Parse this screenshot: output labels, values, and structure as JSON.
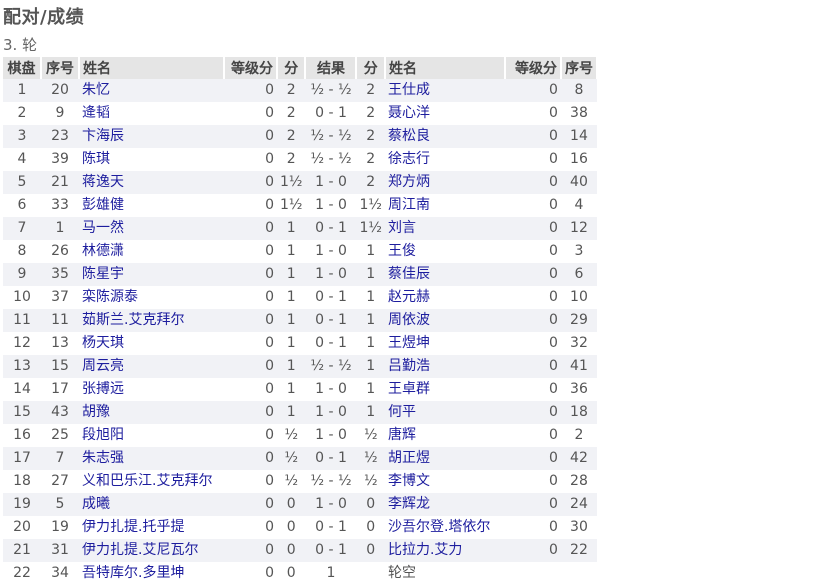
{
  "page_title": "配对/成绩",
  "round_label": "3. 轮",
  "headers": [
    "棋盘",
    "序号",
    "姓名",
    "等级分",
    "分",
    "结果",
    "分",
    "姓名",
    "等级分",
    "序号"
  ],
  "rows": [
    {
      "board": "1",
      "no1": "20",
      "name1": "朱忆",
      "rating1": "0",
      "pts1": "2",
      "result": "½ - ½",
      "pts2": "2",
      "name2": "王仕成",
      "rating2": "0",
      "no2": "8"
    },
    {
      "board": "2",
      "no1": "9",
      "name1": "逄韬",
      "rating1": "0",
      "pts1": "2",
      "result": "0 - 1",
      "pts2": "2",
      "name2": "聂心洋",
      "rating2": "0",
      "no2": "38"
    },
    {
      "board": "3",
      "no1": "23",
      "name1": "卞海辰",
      "rating1": "0",
      "pts1": "2",
      "result": "½ - ½",
      "pts2": "2",
      "name2": "蔡松良",
      "rating2": "0",
      "no2": "14"
    },
    {
      "board": "4",
      "no1": "39",
      "name1": "陈琪",
      "rating1": "0",
      "pts1": "2",
      "result": "½ - ½",
      "pts2": "2",
      "name2": "徐志行",
      "rating2": "0",
      "no2": "16"
    },
    {
      "board": "5",
      "no1": "21",
      "name1": "蒋逸天",
      "rating1": "0",
      "pts1": "1½",
      "result": "1 - 0",
      "pts2": "2",
      "name2": "郑方炳",
      "rating2": "0",
      "no2": "40"
    },
    {
      "board": "6",
      "no1": "33",
      "name1": "彭雄健",
      "rating1": "0",
      "pts1": "1½",
      "result": "1 - 0",
      "pts2": "1½",
      "name2": "周江南",
      "rating2": "0",
      "no2": "4"
    },
    {
      "board": "7",
      "no1": "1",
      "name1": "马一然",
      "rating1": "0",
      "pts1": "1",
      "result": "0 - 1",
      "pts2": "1½",
      "name2": "刘言",
      "rating2": "0",
      "no2": "12"
    },
    {
      "board": "8",
      "no1": "26",
      "name1": "林德潇",
      "rating1": "0",
      "pts1": "1",
      "result": "1 - 0",
      "pts2": "1",
      "name2": "王俊",
      "rating2": "0",
      "no2": "3"
    },
    {
      "board": "9",
      "no1": "35",
      "name1": "陈星宇",
      "rating1": "0",
      "pts1": "1",
      "result": "1 - 0",
      "pts2": "1",
      "name2": "蔡佳辰",
      "rating2": "0",
      "no2": "6"
    },
    {
      "board": "10",
      "no1": "37",
      "name1": "栾陈源泰",
      "rating1": "0",
      "pts1": "1",
      "result": "0 - 1",
      "pts2": "1",
      "name2": "赵元赫",
      "rating2": "0",
      "no2": "10"
    },
    {
      "board": "11",
      "no1": "11",
      "name1": "茹斯兰.艾克拜尔",
      "rating1": "0",
      "pts1": "1",
      "result": "0 - 1",
      "pts2": "1",
      "name2": "周依波",
      "rating2": "0",
      "no2": "29"
    },
    {
      "board": "12",
      "no1": "13",
      "name1": "杨天琪",
      "rating1": "0",
      "pts1": "1",
      "result": "0 - 1",
      "pts2": "1",
      "name2": "王煜坤",
      "rating2": "0",
      "no2": "32"
    },
    {
      "board": "13",
      "no1": "15",
      "name1": "周云亮",
      "rating1": "0",
      "pts1": "1",
      "result": "½ - ½",
      "pts2": "1",
      "name2": "吕勤浩",
      "rating2": "0",
      "no2": "41"
    },
    {
      "board": "14",
      "no1": "17",
      "name1": "张搏远",
      "rating1": "0",
      "pts1": "1",
      "result": "1 - 0",
      "pts2": "1",
      "name2": "王卓群",
      "rating2": "0",
      "no2": "36"
    },
    {
      "board": "15",
      "no1": "43",
      "name1": "胡豫",
      "rating1": "0",
      "pts1": "1",
      "result": "1 - 0",
      "pts2": "1",
      "name2": "何平",
      "rating2": "0",
      "no2": "18"
    },
    {
      "board": "16",
      "no1": "25",
      "name1": "段旭阳",
      "rating1": "0",
      "pts1": "½",
      "result": "1 - 0",
      "pts2": "½",
      "name2": "唐辉",
      "rating2": "0",
      "no2": "2"
    },
    {
      "board": "17",
      "no1": "7",
      "name1": "朱志强",
      "rating1": "0",
      "pts1": "½",
      "result": "0 - 1",
      "pts2": "½",
      "name2": "胡正煜",
      "rating2": "0",
      "no2": "42"
    },
    {
      "board": "18",
      "no1": "27",
      "name1": "义和巴乐江.艾克拜尔",
      "rating1": "0",
      "pts1": "½",
      "result": "½ - ½",
      "pts2": "½",
      "name2": "李博文",
      "rating2": "0",
      "no2": "28"
    },
    {
      "board": "19",
      "no1": "5",
      "name1": "成曦",
      "rating1": "0",
      "pts1": "0",
      "result": "1 - 0",
      "pts2": "0",
      "name2": "李辉龙",
      "rating2": "0",
      "no2": "24"
    },
    {
      "board": "20",
      "no1": "19",
      "name1": "伊力扎提.托乎提",
      "rating1": "0",
      "pts1": "0",
      "result": "0 - 1",
      "pts2": "0",
      "name2": "沙吾尔登.塔依尔",
      "rating2": "0",
      "no2": "30"
    },
    {
      "board": "21",
      "no1": "31",
      "name1": "伊力扎提.艾尼瓦尔",
      "rating1": "0",
      "pts1": "0",
      "result": "0 - 1",
      "pts2": "0",
      "name2": "比拉力.艾力",
      "rating2": "0",
      "no2": "22"
    },
    {
      "board": "22",
      "no1": "34",
      "name1": "吾特库尔.多里坤",
      "rating1": "0",
      "pts1": "0",
      "result": "1",
      "pts2": "",
      "name2": "轮空",
      "rating2": "",
      "no2": "",
      "bye": true
    }
  ]
}
